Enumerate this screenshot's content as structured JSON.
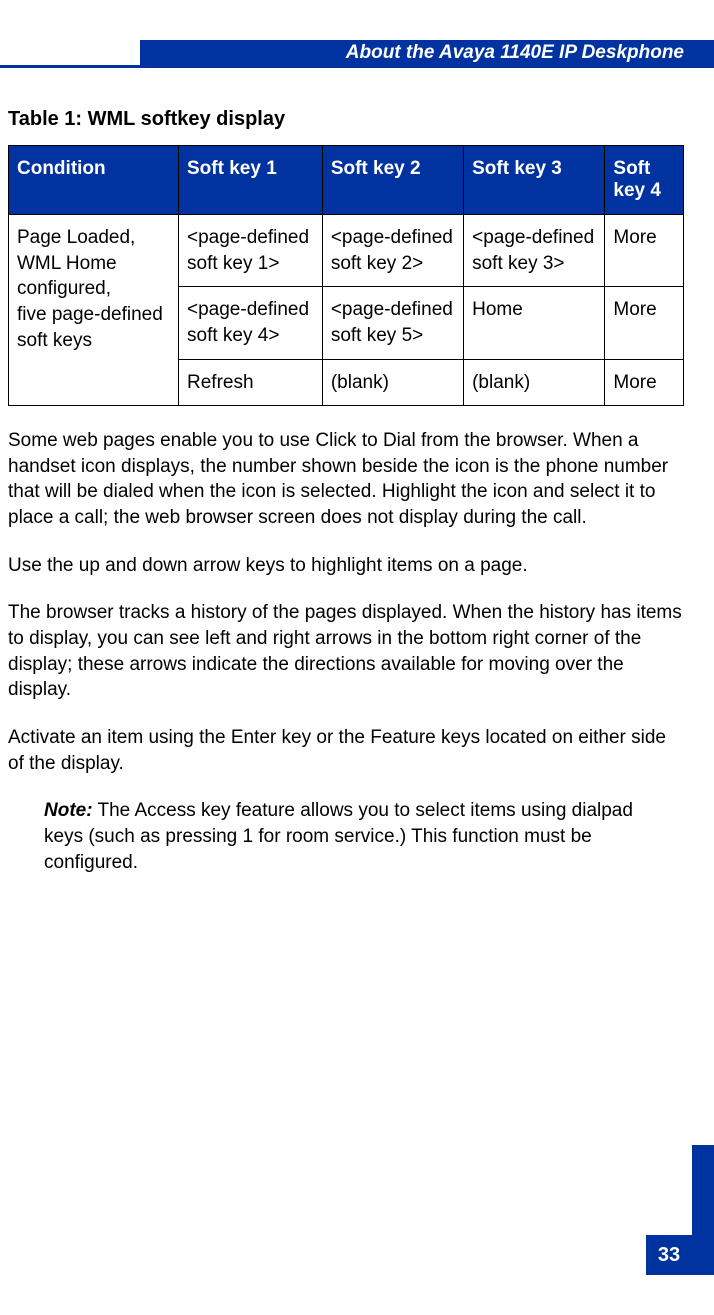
{
  "header": {
    "title": "About the Avaya 1140E IP Deskphone"
  },
  "table": {
    "title": "Table 1: WML softkey display",
    "headers": {
      "condition": "Condition",
      "sk1": "Soft key 1",
      "sk2": "Soft key 2",
      "sk3": "Soft key 3",
      "sk4": "Soft key 4"
    },
    "condition_cell": "Page Loaded, WML Home configured,\nfive page-defined soft keys",
    "rows": [
      {
        "c1": " <page-defined soft key 1>",
        "c2": "<page-defined soft key 2>",
        "c3": " <page-defined soft key 3>",
        "c4": " More"
      },
      {
        "c1": " <page-defined soft key 4>",
        "c2": " <page-defined soft key 5>",
        "c3": " Home",
        "c4": " More"
      },
      {
        "c1": "Refresh",
        "c2": "(blank)",
        "c3": "(blank)",
        "c4": "More"
      }
    ]
  },
  "paragraphs": {
    "p1": "Some web pages enable you to use Click to Dial from the browser. When a handset icon displays, the number shown beside the icon is the phone number that will be dialed when the icon is selected. Highlight the icon and select it to place a call; the web browser screen does not display during the call.",
    "p2": "Use the up and down arrow keys to highlight items on a page.",
    "p3": "The browser tracks a history of the pages displayed. When the history has items to display, you can see left and right arrows in the bottom right corner of the display; these arrows indicate the directions available for moving over the display.",
    "p4": "Activate an item using the Enter key or the Feature keys located on either side of the display."
  },
  "note": {
    "label": "Note:",
    "text": " The Access key feature allows you to select items using dialpad keys (such as pressing 1 for room service.) This function must be configured."
  },
  "footer": {
    "page": "33"
  }
}
